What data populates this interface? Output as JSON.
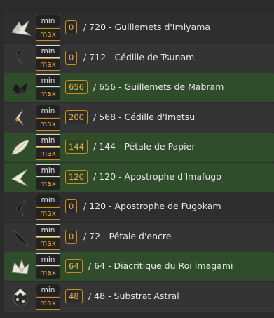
{
  "rows": [
    {
      "min": "min",
      "max": "max",
      "count": "0",
      "text": "/ 720  -  Guillemets d'Imiyama",
      "icon": "white-folded-paper-icon",
      "bg": "dark"
    },
    {
      "min": "min",
      "max": "max",
      "count": "0",
      "text": "/ 712  -  Cédille de Tsunam",
      "icon": "black-cedilla-icon",
      "bg": "mid"
    },
    {
      "min": "min",
      "max": "max",
      "count": "656",
      "text": "/ 656  -  Guillemets de Mabram",
      "icon": "dark-folded-paper-icon",
      "bg": "green"
    },
    {
      "min": "min",
      "max": "max",
      "count": "200",
      "text": "/ 568  -  Cédille d'Imetsu",
      "icon": "orange-cedilla-icon",
      "bg": "mid"
    },
    {
      "min": "min",
      "max": "max",
      "count": "144",
      "text": "/ 144  -  Pétale de Papier",
      "icon": "paper-petal-icon",
      "bg": "green"
    },
    {
      "min": "min",
      "max": "max",
      "count": "120",
      "text": "/ 120  -  Apostrophe d'Imafugo",
      "icon": "white-apostrophe-icon",
      "bg": "green"
    },
    {
      "min": "min",
      "max": "max",
      "count": "0",
      "text": "/ 120  -  Apostrophe de Fugokam",
      "icon": "black-apostrophe-icon",
      "bg": "dark"
    },
    {
      "min": "min",
      "max": "max",
      "count": "0",
      "text": "/ 72  -  Pétale d'encre",
      "icon": "ink-petal-icon",
      "bg": "mid"
    },
    {
      "min": "min",
      "max": "max",
      "count": "64",
      "text": "/ 64  -  Diacritique du Roi Imagami",
      "icon": "white-crown-origami-icon",
      "bg": "green"
    },
    {
      "min": "min",
      "max": "max",
      "count": "48",
      "text": "/ 48  -  Substrat Astral",
      "icon": "astral-substrate-icon",
      "bg": "mid"
    }
  ],
  "colors": {
    "green_row": "#2f4d2a",
    "dark_row": "#2e2e2e",
    "accent": "#e7a53a"
  }
}
